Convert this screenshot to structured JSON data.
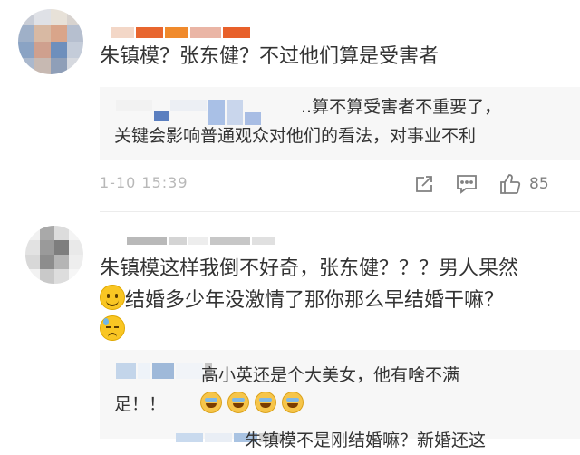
{
  "comments": [
    {
      "text": "朱镇模？张东健？不过他们算是受害者",
      "reply": {
        "line1": "..算不算受害者不重要了，",
        "line2": "关键会影响普通观众对他们的看法，对事业不利"
      },
      "time": "1-10 15:39",
      "likes": "85"
    },
    {
      "text_line1": "朱镇模这样我倒不好奇，张东健？？？男人果然",
      "text_line2": "结婚多少年没激情了那你那么早结婚干嘛？",
      "replies": [
        {
          "line1": "高小英还是个大美女，他有啥不满",
          "line2": "足！！"
        },
        {
          "line1": "朱镇模不是刚结婚嘛？新婚还这"
        }
      ]
    }
  ],
  "icons": {
    "share": "share-icon",
    "comment": "comment-icon",
    "like": "thumbs-up-icon",
    "emoji_smile": "smile-emoji-icon",
    "emoji_sweat": "sweat-emoji-icon",
    "emoji_laugh": "laugh-emoji-icon"
  },
  "colors": {
    "text": "#333333",
    "meta": "#808080",
    "time": "#b8b8b8",
    "reply_bg": "#f7f7f7"
  }
}
